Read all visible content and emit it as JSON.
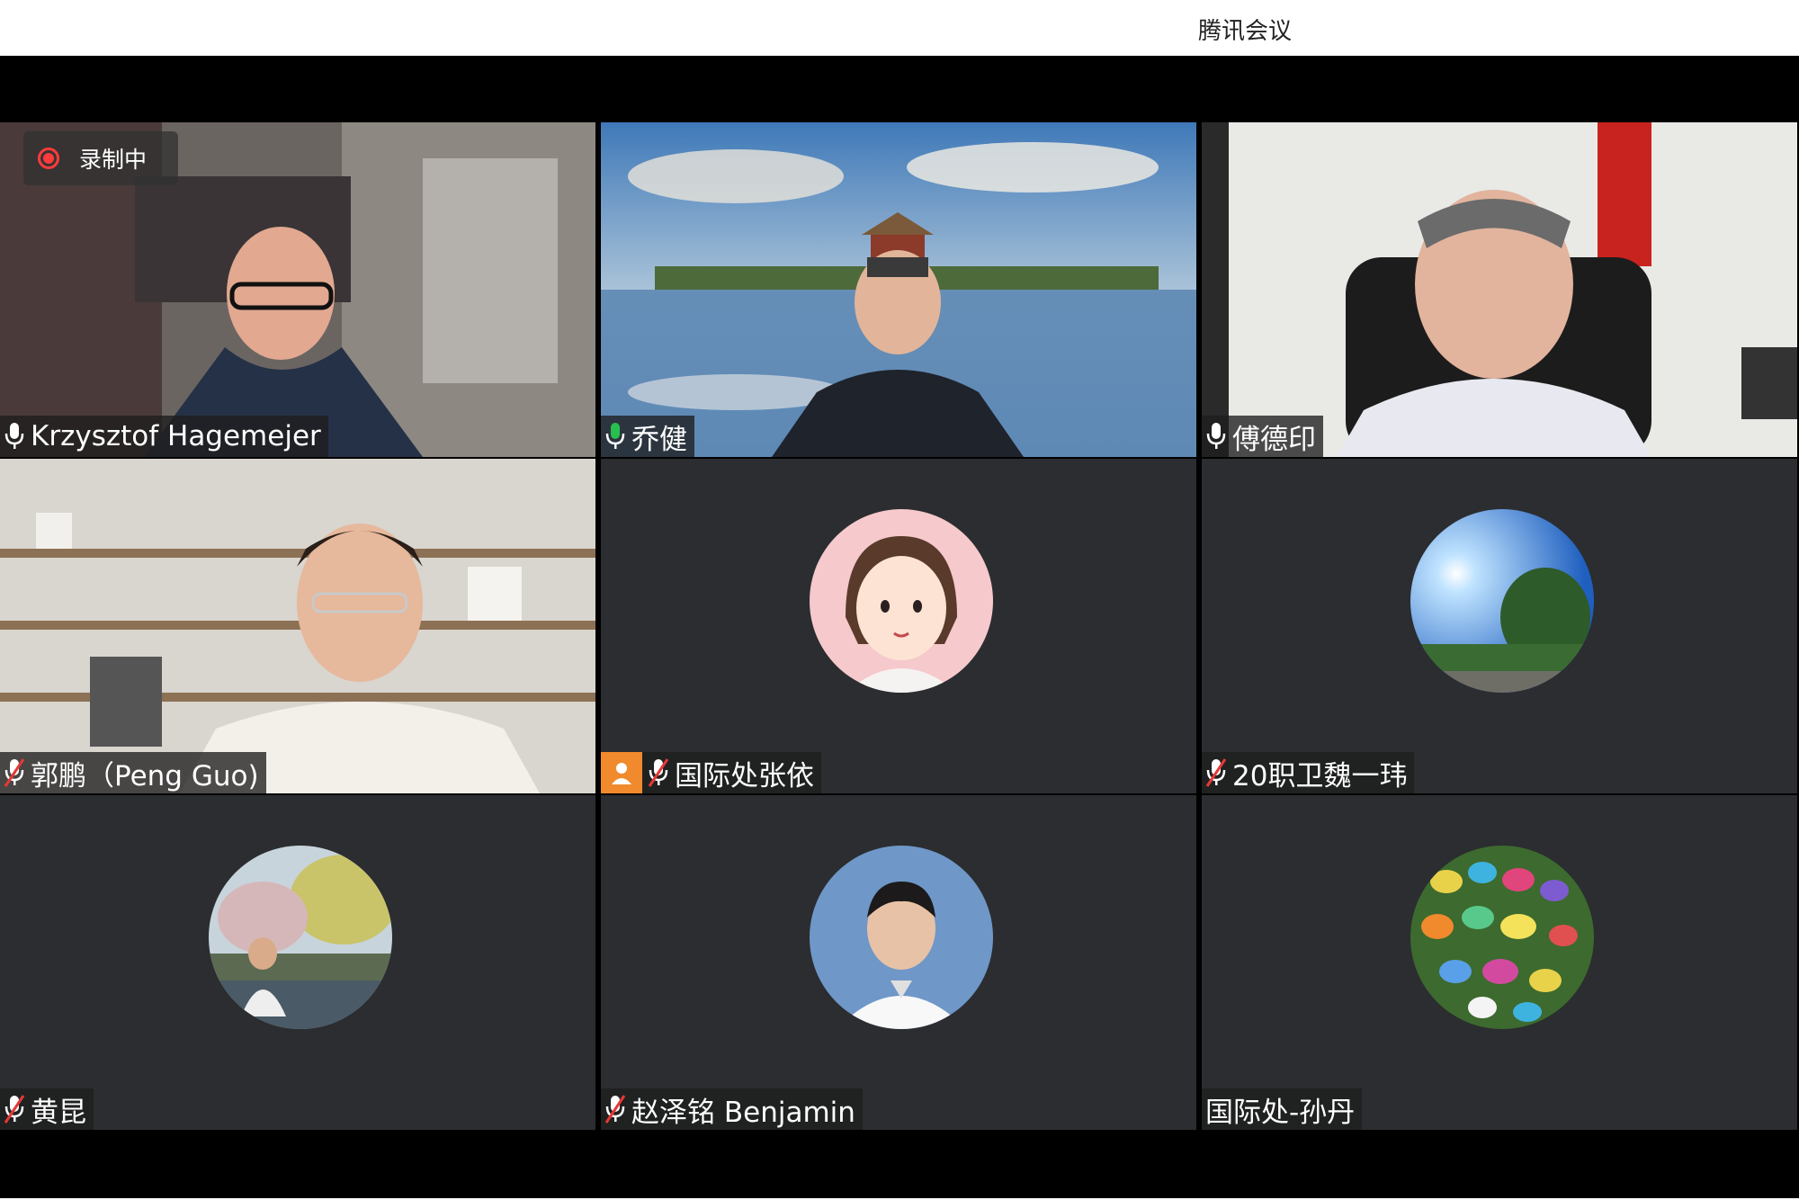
{
  "app": {
    "title": "腾讯会议"
  },
  "recording": {
    "label": "录制中"
  },
  "participants": [
    {
      "name": "Krzysztof Hagemejer",
      "mic": "on"
    },
    {
      "name": "乔健",
      "mic": "speaking"
    },
    {
      "name": "傅德印",
      "mic": "on"
    },
    {
      "name": "郭鹏（Peng Guo)",
      "mic": "muted"
    },
    {
      "name": "国际处张依",
      "mic": "muted"
    },
    {
      "name": "20职卫魏一玮",
      "mic": "muted"
    },
    {
      "name": "黄昆",
      "mic": "muted"
    },
    {
      "name": "赵泽铭 Benjamin",
      "mic": "muted"
    },
    {
      "name": "国际处-孙丹",
      "mic": "none"
    }
  ],
  "colors": {
    "active_border": "#27c04f",
    "record_red": "#ff3b3b",
    "tile_bg": "#2b2d30",
    "person_icon": "#f08a2c"
  }
}
